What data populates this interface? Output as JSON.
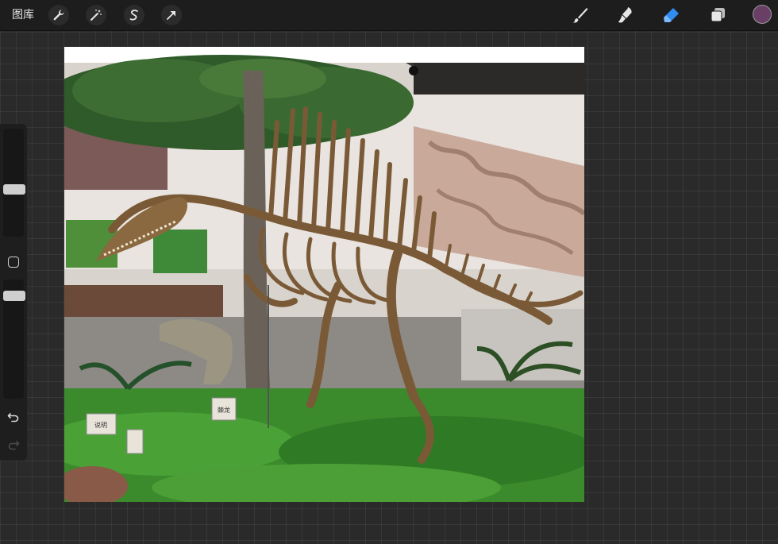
{
  "toolbar": {
    "gallery_label": "图库",
    "color": "#6a3f66"
  },
  "artwork": {
    "signs": [
      "棘龙",
      "说明"
    ]
  }
}
